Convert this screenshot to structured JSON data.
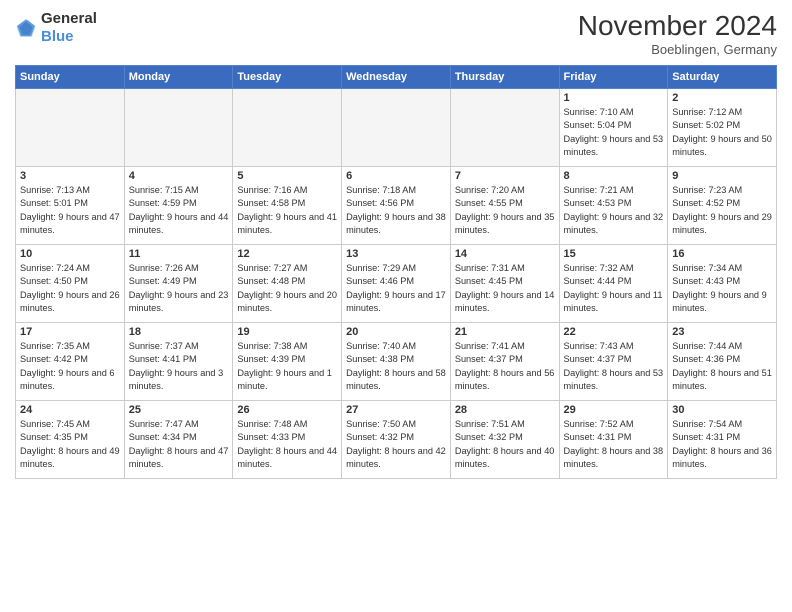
{
  "header": {
    "logo_general": "General",
    "logo_blue": "Blue",
    "month_title": "November 2024",
    "location": "Boeblingen, Germany"
  },
  "weekdays": [
    "Sunday",
    "Monday",
    "Tuesday",
    "Wednesday",
    "Thursday",
    "Friday",
    "Saturday"
  ],
  "weeks": [
    [
      {
        "day": "",
        "info": ""
      },
      {
        "day": "",
        "info": ""
      },
      {
        "day": "",
        "info": ""
      },
      {
        "day": "",
        "info": ""
      },
      {
        "day": "",
        "info": ""
      },
      {
        "day": "1",
        "info": "Sunrise: 7:10 AM\nSunset: 5:04 PM\nDaylight: 9 hours and 53 minutes."
      },
      {
        "day": "2",
        "info": "Sunrise: 7:12 AM\nSunset: 5:02 PM\nDaylight: 9 hours and 50 minutes."
      }
    ],
    [
      {
        "day": "3",
        "info": "Sunrise: 7:13 AM\nSunset: 5:01 PM\nDaylight: 9 hours and 47 minutes."
      },
      {
        "day": "4",
        "info": "Sunrise: 7:15 AM\nSunset: 4:59 PM\nDaylight: 9 hours and 44 minutes."
      },
      {
        "day": "5",
        "info": "Sunrise: 7:16 AM\nSunset: 4:58 PM\nDaylight: 9 hours and 41 minutes."
      },
      {
        "day": "6",
        "info": "Sunrise: 7:18 AM\nSunset: 4:56 PM\nDaylight: 9 hours and 38 minutes."
      },
      {
        "day": "7",
        "info": "Sunrise: 7:20 AM\nSunset: 4:55 PM\nDaylight: 9 hours and 35 minutes."
      },
      {
        "day": "8",
        "info": "Sunrise: 7:21 AM\nSunset: 4:53 PM\nDaylight: 9 hours and 32 minutes."
      },
      {
        "day": "9",
        "info": "Sunrise: 7:23 AM\nSunset: 4:52 PM\nDaylight: 9 hours and 29 minutes."
      }
    ],
    [
      {
        "day": "10",
        "info": "Sunrise: 7:24 AM\nSunset: 4:50 PM\nDaylight: 9 hours and 26 minutes."
      },
      {
        "day": "11",
        "info": "Sunrise: 7:26 AM\nSunset: 4:49 PM\nDaylight: 9 hours and 23 minutes."
      },
      {
        "day": "12",
        "info": "Sunrise: 7:27 AM\nSunset: 4:48 PM\nDaylight: 9 hours and 20 minutes."
      },
      {
        "day": "13",
        "info": "Sunrise: 7:29 AM\nSunset: 4:46 PM\nDaylight: 9 hours and 17 minutes."
      },
      {
        "day": "14",
        "info": "Sunrise: 7:31 AM\nSunset: 4:45 PM\nDaylight: 9 hours and 14 minutes."
      },
      {
        "day": "15",
        "info": "Sunrise: 7:32 AM\nSunset: 4:44 PM\nDaylight: 9 hours and 11 minutes."
      },
      {
        "day": "16",
        "info": "Sunrise: 7:34 AM\nSunset: 4:43 PM\nDaylight: 9 hours and 9 minutes."
      }
    ],
    [
      {
        "day": "17",
        "info": "Sunrise: 7:35 AM\nSunset: 4:42 PM\nDaylight: 9 hours and 6 minutes."
      },
      {
        "day": "18",
        "info": "Sunrise: 7:37 AM\nSunset: 4:41 PM\nDaylight: 9 hours and 3 minutes."
      },
      {
        "day": "19",
        "info": "Sunrise: 7:38 AM\nSunset: 4:39 PM\nDaylight: 9 hours and 1 minute."
      },
      {
        "day": "20",
        "info": "Sunrise: 7:40 AM\nSunset: 4:38 PM\nDaylight: 8 hours and 58 minutes."
      },
      {
        "day": "21",
        "info": "Sunrise: 7:41 AM\nSunset: 4:37 PM\nDaylight: 8 hours and 56 minutes."
      },
      {
        "day": "22",
        "info": "Sunrise: 7:43 AM\nSunset: 4:37 PM\nDaylight: 8 hours and 53 minutes."
      },
      {
        "day": "23",
        "info": "Sunrise: 7:44 AM\nSunset: 4:36 PM\nDaylight: 8 hours and 51 minutes."
      }
    ],
    [
      {
        "day": "24",
        "info": "Sunrise: 7:45 AM\nSunset: 4:35 PM\nDaylight: 8 hours and 49 minutes."
      },
      {
        "day": "25",
        "info": "Sunrise: 7:47 AM\nSunset: 4:34 PM\nDaylight: 8 hours and 47 minutes."
      },
      {
        "day": "26",
        "info": "Sunrise: 7:48 AM\nSunset: 4:33 PM\nDaylight: 8 hours and 44 minutes."
      },
      {
        "day": "27",
        "info": "Sunrise: 7:50 AM\nSunset: 4:32 PM\nDaylight: 8 hours and 42 minutes."
      },
      {
        "day": "28",
        "info": "Sunrise: 7:51 AM\nSunset: 4:32 PM\nDaylight: 8 hours and 40 minutes."
      },
      {
        "day": "29",
        "info": "Sunrise: 7:52 AM\nSunset: 4:31 PM\nDaylight: 8 hours and 38 minutes."
      },
      {
        "day": "30",
        "info": "Sunrise: 7:54 AM\nSunset: 4:31 PM\nDaylight: 8 hours and 36 minutes."
      }
    ]
  ]
}
